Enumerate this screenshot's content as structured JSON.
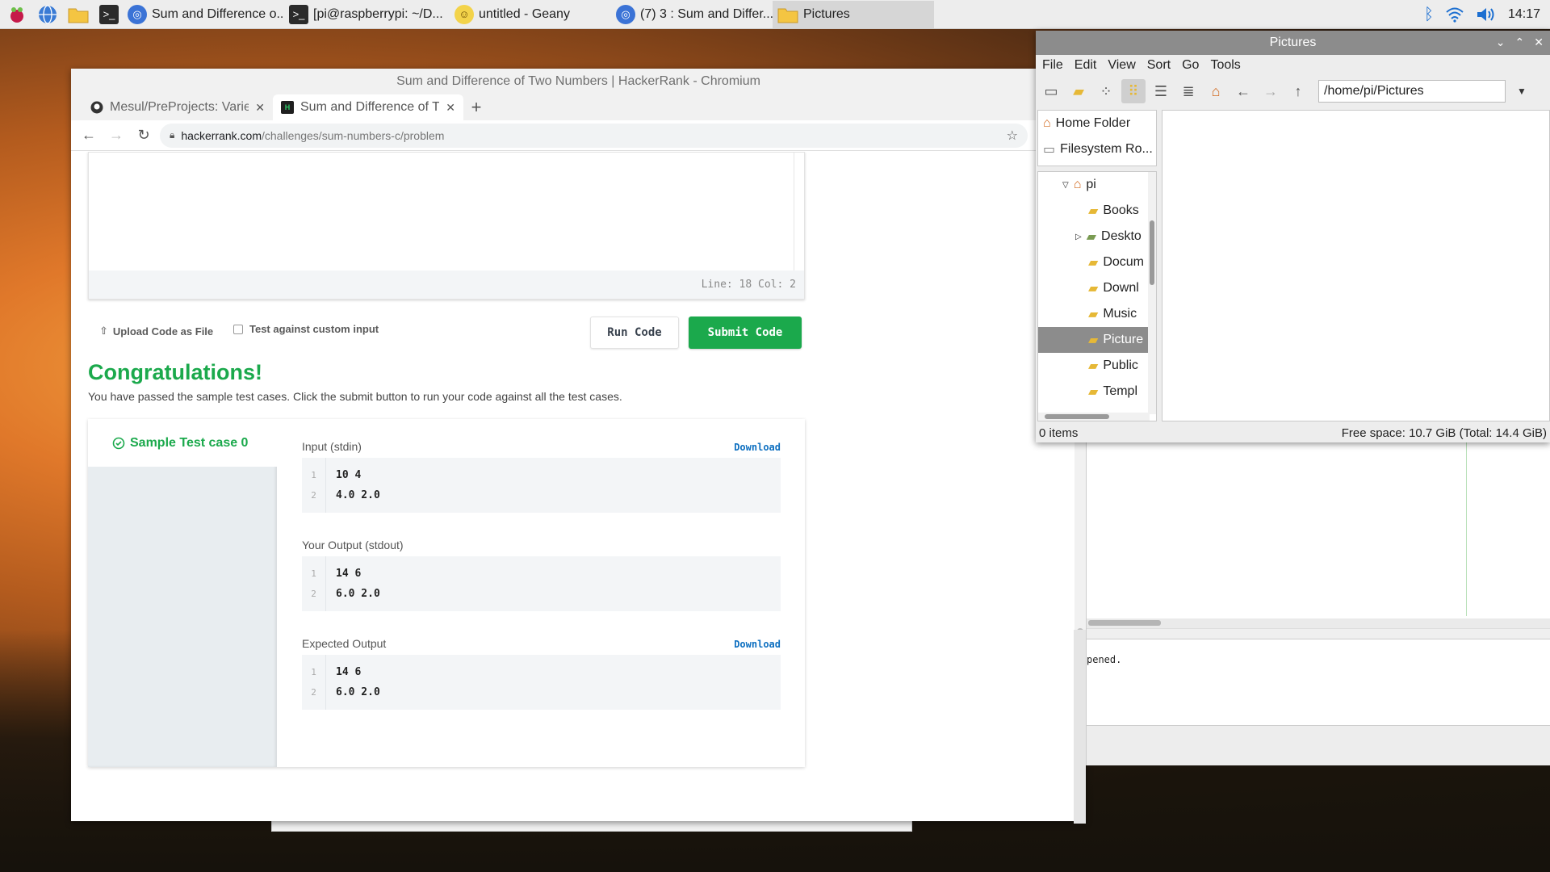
{
  "taskbar": {
    "items": [
      {
        "label": "Sum and Difference o...",
        "icon": "chromium-icon"
      },
      {
        "label": "[pi@raspberrypi: ~/D...",
        "icon": "terminal-icon"
      },
      {
        "label": "untitled - Geany",
        "icon": "geany-icon"
      },
      {
        "label": "(7) 3 : Sum and Differ...",
        "icon": "chromium-icon"
      },
      {
        "label": "Pictures",
        "icon": "folder-icon"
      }
    ],
    "clock": "14:17"
  },
  "chromium": {
    "title": "Sum and Difference of Two Numbers | HackerRank - Chromium",
    "tabs": [
      {
        "label": "Mesul/PreProjects: Varie"
      },
      {
        "label": "Sum and Difference of T"
      }
    ],
    "url_host": "hackerrank.com",
    "url_path": "/challenges/sum-numbers-c/problem"
  },
  "editor": {
    "status": "Line: 18 Col: 2"
  },
  "actions": {
    "upload_label": "Upload Code as File",
    "custom_input_label": "Test against custom input",
    "run_label": "Run Code",
    "submit_label": "Submit Code"
  },
  "result": {
    "title": "Congratulations!",
    "message": "You have passed the sample test cases. Click the submit button to run your code against all the test cases.",
    "tab_label": "Sample Test case 0",
    "blocks": [
      {
        "label": "Input (stdin)",
        "download": "Download",
        "lines": [
          "10 4",
          "4.0 2.0"
        ]
      },
      {
        "label": "Your Output (stdout)",
        "download": "",
        "lines": [
          "14 6",
          "6.0 2.0"
        ]
      },
      {
        "label": "Expected Output",
        "download": "Download",
        "lines": [
          "14 6",
          "6.0 2.0"
        ]
      }
    ]
  },
  "filemanager": {
    "title": "Pictures",
    "menu": [
      "File",
      "Edit",
      "View",
      "Sort",
      "Go",
      "Tools"
    ],
    "path": "/home/pi/Pictures",
    "places": [
      "Home Folder",
      "Filesystem Ro..."
    ],
    "tree": [
      "pi",
      "Books",
      "Deskto",
      "Docum",
      "Downl",
      "Music",
      "Picture",
      "Public",
      "Templ"
    ],
    "status_left": "0 items",
    "status_right": "Free space: 10.7 GiB (Total: 14.4 GiB)"
  },
  "geany": {
    "message": "pened."
  },
  "colors": {
    "accent_green": "#1ba94c",
    "link_blue": "#0d6fc0",
    "selection_gray": "#8c8c8c"
  }
}
